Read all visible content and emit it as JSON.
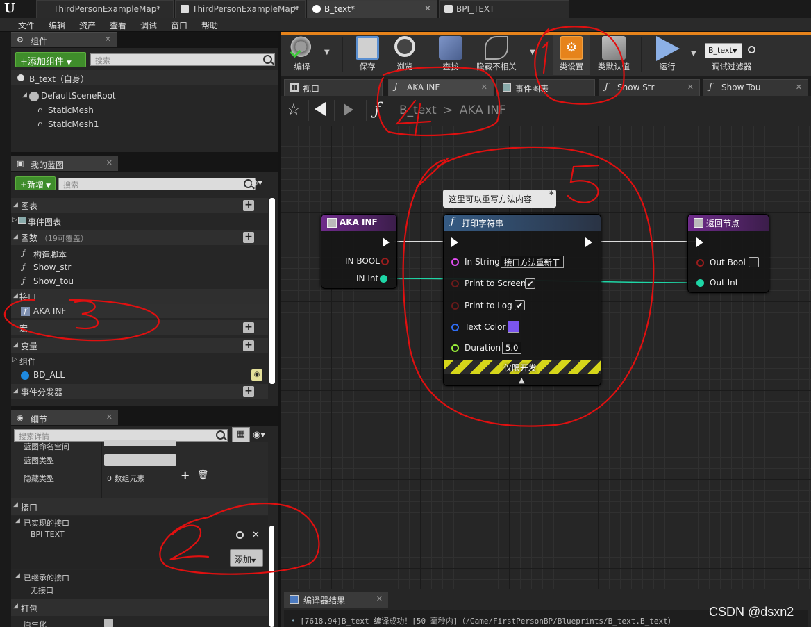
{
  "titlebar": {
    "tabs": [
      {
        "label": "ThirdPersonExampleMap*",
        "active": false
      },
      {
        "label": "ThirdPersonExampleMap*",
        "active": false
      },
      {
        "label": "B_text*",
        "active": true
      },
      {
        "label": "BPI_TEXT",
        "active": false
      }
    ]
  },
  "menubar": [
    "文件",
    "编辑",
    "资产",
    "查看",
    "调试",
    "窗口",
    "帮助"
  ],
  "components": {
    "tab_label": "组件",
    "add_button": "+添加组件",
    "search_placeholder": "搜索",
    "self_label": "B_text（自身）",
    "tree": [
      "DefaultSceneRoot",
      "StaticMesh",
      "StaticMesh1"
    ]
  },
  "my_blueprint": {
    "tab_label": "我的蓝图",
    "new_button": "+新增",
    "search_placeholder": "搜索",
    "sections": {
      "graphs": "图表",
      "event_graph": "事件图表",
      "functions": "函数",
      "functions_count": "（19可覆盖）",
      "func_items": [
        "构造脚本",
        "Show_str",
        "Show_tou"
      ],
      "interfaces": "接口",
      "interface_items": [
        "AKA INF"
      ],
      "macros": "宏",
      "variables": "变量",
      "components": "组件",
      "variable_items": [
        "BD_ALL"
      ],
      "dispatchers": "事件分发器"
    }
  },
  "details": {
    "tab_label": "细节",
    "search_placeholder": "搜索详情",
    "rows": [
      {
        "label": "蓝图命名空间",
        "value": ""
      },
      {
        "label": "蓝图类型",
        "value": ""
      },
      {
        "label": "隐藏类型",
        "value": "0 数组元素"
      }
    ],
    "interface_section": "接口",
    "implemented_label": "已实现的接口",
    "implemented_item": "BPI TEXT",
    "add_button": "添加",
    "inherited_label": "已继承的接口",
    "inherited_item": "无接口",
    "packaging_section": "打包",
    "packaging_row": "原生化"
  },
  "toolbar": {
    "buttons": [
      "编译",
      "保存",
      "浏览",
      "查找",
      "隐藏不相关",
      "类设置",
      "类默认值",
      "运行"
    ],
    "debug_select": "B_text",
    "debug_filter": "调试过滤器"
  },
  "graph_tabs": [
    "视口",
    "AKA INF",
    "事件图表",
    "Show Str",
    "Show Tou"
  ],
  "breadcrumb": {
    "root": "B_text",
    "sep": ">",
    "current": "AKA INF"
  },
  "nodes": {
    "entry": {
      "title": "AKA INF",
      "pins": [
        "IN BOOL",
        "IN Int"
      ]
    },
    "comment": "这里可以重写方法内容",
    "print": {
      "title": "打印字符串",
      "in_string_label": "In String",
      "in_string_value": "接口方法重新干",
      "print_screen": "Print to Screen",
      "print_log": "Print to Log",
      "text_color": "Text Color",
      "duration": "Duration",
      "duration_value": "5.0",
      "dev_only": "仅限开发"
    },
    "return": {
      "title": "返回节点",
      "pins": [
        "Out Bool",
        "Out Int"
      ]
    }
  },
  "compiler": {
    "tab_label": "编译器结果",
    "log": "[7618.94]B_text 编译成功！[50 毫秒内]（/Game/FirstPersonBP/Blueprints/B_text.B_text）"
  },
  "watermark": "CSDN @dsxn2",
  "colors": {
    "exec_pin": "#ffffff",
    "int_pin": "#1ed6a6",
    "bool_pin": "#9a1d1d",
    "string_pin": "#e34df2",
    "struct_pin": "#2f6df5",
    "float_pin": "#9bf23a",
    "accent_orange": "#e6831b",
    "text_color_swatch": "#7b55ef"
  }
}
